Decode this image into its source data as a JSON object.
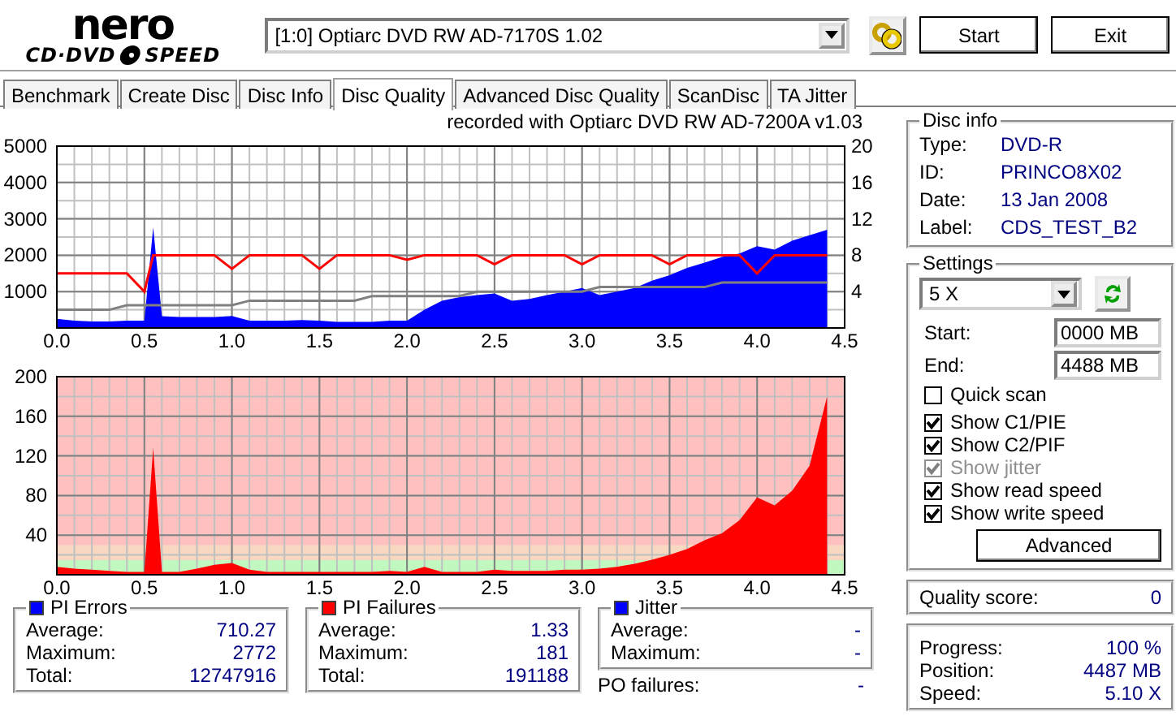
{
  "logo": {
    "word": "nero",
    "product_left": "CD·DVD",
    "product_right": "SPEED"
  },
  "toolbar": {
    "drive": "[1:0]  Optiarc DVD RW AD-7170S 1.02",
    "start": "Start",
    "exit": "Exit"
  },
  "tabs": [
    {
      "label": "Benchmark",
      "selected": false
    },
    {
      "label": "Create Disc",
      "selected": false
    },
    {
      "label": "Disc Info",
      "selected": false
    },
    {
      "label": "Disc Quality",
      "selected": true
    },
    {
      "label": "Advanced Disc Quality",
      "selected": false
    },
    {
      "label": "ScanDisc",
      "selected": false
    },
    {
      "label": "TA Jitter",
      "selected": false
    }
  ],
  "chart_title": "recorded with Optiarc DVD RW AD-7200A  v1.03",
  "charts": [
    {
      "chart_data": {
        "type": "area",
        "grid": true,
        "xlim": [
          0,
          4.5
        ],
        "ylim": [
          0,
          5000
        ],
        "y2lim": [
          0,
          20
        ],
        "xticks": [
          {
            "value": 0,
            "label": "0.0"
          },
          {
            "value": 0.5,
            "label": "0.5"
          },
          {
            "value": 1,
            "label": "1.0"
          },
          {
            "value": 1.5,
            "label": "1.5"
          },
          {
            "value": 2,
            "label": "2.0"
          },
          {
            "value": 2.5,
            "label": "2.5"
          },
          {
            "value": 3,
            "label": "3.0"
          },
          {
            "value": 3.5,
            "label": "3.5"
          },
          {
            "value": 4,
            "label": "4.0"
          },
          {
            "value": 4.5,
            "label": "4.5"
          }
        ],
        "yticks": [
          1000,
          2000,
          3000,
          4000,
          5000
        ],
        "y2ticks": [
          4,
          8,
          12,
          16,
          20
        ],
        "x": [
          0,
          0.1,
          0.2,
          0.3,
          0.4,
          0.5,
          0.55,
          0.6,
          0.7,
          0.8,
          0.9,
          1,
          1.1,
          1.2,
          1.3,
          1.4,
          1.5,
          1.6,
          1.7,
          1.8,
          1.9,
          2,
          2.1,
          2.2,
          2.3,
          2.4,
          2.5,
          2.6,
          2.7,
          2.8,
          2.9,
          3,
          3.1,
          3.2,
          3.3,
          3.4,
          3.5,
          3.6,
          3.7,
          3.8,
          3.9,
          4,
          4.1,
          4.2,
          4.3,
          4.4
        ],
        "series": [
          {
            "color": "#0000ff",
            "values": [
              250,
              200,
              180,
              180,
              200,
              200,
              2770,
              320,
              300,
              300,
              300,
              330,
              200,
              200,
              200,
              220,
              200,
              170,
              170,
              170,
              200,
              200,
              500,
              750,
              850,
              900,
              950,
              750,
              800,
              900,
              1000,
              1100,
              900,
              1000,
              1100,
              1300,
              1450,
              1650,
              1800,
              1950,
              2050,
              2250,
              2150,
              2400,
              2550,
              2700
            ]
          },
          {
            "color": "#ff0000",
            "axis": "y2",
            "type": "line",
            "values": [
              6,
              6,
              6,
              6,
              6,
              4,
              8,
              8,
              8,
              8,
              8,
              6.5,
              8,
              8,
              8,
              8,
              6.5,
              8,
              8,
              8,
              8,
              7.5,
              8,
              8,
              8,
              8,
              7,
              8,
              8,
              8,
              8,
              7,
              8,
              8,
              8,
              8,
              7,
              8,
              8,
              8,
              8,
              6,
              8,
              8,
              8,
              8
            ]
          },
          {
            "color": "#808080",
            "axis": "y2",
            "type": "line",
            "values": [
              2,
              2,
              2,
              2,
              2.5,
              2.5,
              2.5,
              2.5,
              2.5,
              2.5,
              2.5,
              2.5,
              3,
              3,
              3,
              3,
              3,
              3,
              3,
              3.5,
              3.5,
              3.5,
              3.5,
              3.5,
              3.5,
              4,
              4,
              4,
              4,
              4,
              4,
              4,
              4.5,
              4.5,
              4.5,
              4.5,
              4.5,
              4.5,
              4.5,
              5,
              5,
              5,
              5,
              5,
              5,
              5
            ]
          }
        ]
      }
    },
    {
      "chart_data": {
        "type": "area",
        "grid": true,
        "xlim": [
          0,
          4.5
        ],
        "ylim": [
          0,
          200
        ],
        "bands": [
          {
            "axis": "y",
            "from": 0,
            "to": 15,
            "color": "#c0f8c0"
          },
          {
            "axis": "y",
            "from": 15,
            "to": 30,
            "color": "#f8d8c0"
          }
        ],
        "xticks": [
          {
            "value": 0,
            "label": "0.0"
          },
          {
            "value": 0.5,
            "label": "0.5"
          },
          {
            "value": 1,
            "label": "1.0"
          },
          {
            "value": 1.5,
            "label": "1.5"
          },
          {
            "value": 2,
            "label": "2.0"
          },
          {
            "value": 2.5,
            "label": "2.5"
          },
          {
            "value": 3,
            "label": "3.0"
          },
          {
            "value": 3.5,
            "label": "3.5"
          },
          {
            "value": 4,
            "label": "4.0"
          },
          {
            "value": 4.5,
            "label": "4.5"
          }
        ],
        "yticks": [
          40,
          80,
          120,
          160,
          200
        ],
        "x": [
          0,
          0.1,
          0.2,
          0.3,
          0.4,
          0.5,
          0.55,
          0.6,
          0.7,
          0.8,
          0.9,
          1,
          1.1,
          1.2,
          1.3,
          1.4,
          1.5,
          1.6,
          1.7,
          1.8,
          1.9,
          2,
          2.1,
          2.2,
          2.3,
          2.4,
          2.5,
          2.6,
          2.7,
          2.8,
          2.9,
          3,
          3.1,
          3.2,
          3.3,
          3.4,
          3.5,
          3.6,
          3.7,
          3.8,
          3.9,
          4,
          4.1,
          4.2,
          4.3,
          4.4
        ],
        "series": [
          {
            "color": "#ff0000",
            "values": [
              8,
              6,
              5,
              4,
              3,
              3,
              128,
              3,
              3,
              6,
              10,
              12,
              5,
              3,
              3,
              3,
              3,
              3,
              3,
              3,
              4,
              3,
              8,
              3,
              3,
              3,
              5,
              4,
              4,
              4,
              5,
              5,
              6,
              8,
              11,
              15,
              20,
              26,
              35,
              42,
              55,
              78,
              70,
              85,
              110,
              180
            ]
          }
        ]
      }
    }
  ],
  "disc_info": {
    "title": "Disc info",
    "fields": [
      {
        "label": "Type:",
        "value": "DVD-R"
      },
      {
        "label": "ID:",
        "value": "PRINCO8X02"
      },
      {
        "label": "Date:",
        "value": "13 Jan 2008"
      },
      {
        "label": "Label:",
        "value": "CDS_TEST_B2"
      }
    ]
  },
  "settings": {
    "title": "Settings",
    "speed": "5 X",
    "start_label": "Start:",
    "start": "0000 MB",
    "end_label": "End:",
    "end": "4488 MB",
    "checkboxes": [
      {
        "label": "Quick scan",
        "checked": false,
        "disabled": false
      },
      {
        "label": "Show C1/PIE",
        "checked": true,
        "disabled": false
      },
      {
        "label": "Show C2/PIF",
        "checked": true,
        "disabled": false
      },
      {
        "label": "Show jitter",
        "checked": true,
        "disabled": true
      },
      {
        "label": "Show read speed",
        "checked": true,
        "disabled": false
      },
      {
        "label": "Show write speed",
        "checked": true,
        "disabled": false
      }
    ],
    "advanced": "Advanced"
  },
  "quality": {
    "label": "Quality score:",
    "value": "0"
  },
  "stats": [
    {
      "title": "PI Errors",
      "color": "#0000ff",
      "rows": [
        {
          "label": "Average:",
          "value": "710.27"
        },
        {
          "label": "Maximum:",
          "value": "2772"
        },
        {
          "label": "Total:",
          "value": "12747916"
        }
      ]
    },
    {
      "title": "PI Failures",
      "color": "#ff0000",
      "rows": [
        {
          "label": "Average:",
          "value": "1.33"
        },
        {
          "label": "Maximum:",
          "value": "181"
        },
        {
          "label": "Total:",
          "value": "191188"
        }
      ]
    },
    {
      "title": "Jitter",
      "color": "#0000ff",
      "rows": [
        {
          "label": "Average:",
          "value": "-"
        },
        {
          "label": "Maximum:",
          "value": "-"
        }
      ]
    }
  ],
  "po_failures": {
    "label": "PO failures:",
    "value": "-"
  },
  "progress": [
    {
      "label": "Progress:",
      "value": "100 %"
    },
    {
      "label": "Position:",
      "value": "4487 MB"
    },
    {
      "label": "Speed:",
      "value": "5.10 X"
    }
  ]
}
